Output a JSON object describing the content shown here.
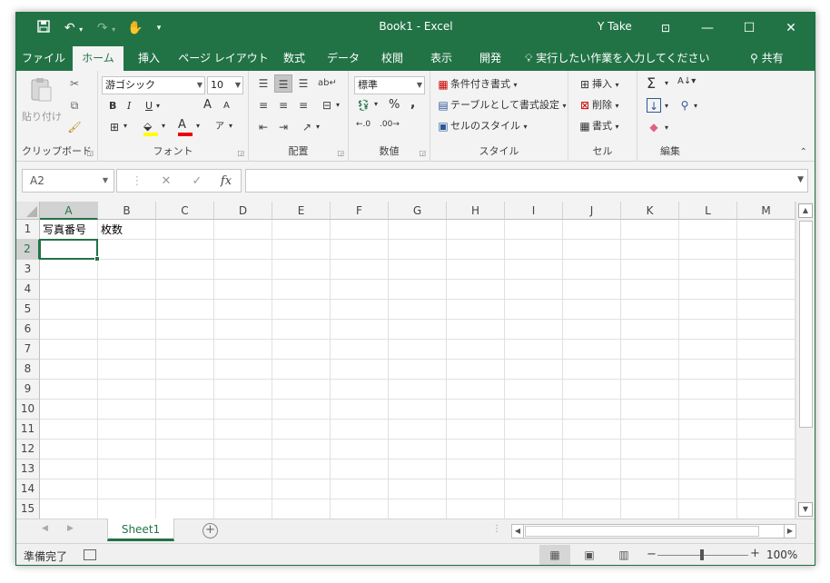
{
  "window": {
    "title": "Book1  -  Excel",
    "user": "Y Take"
  },
  "tabs": [
    "ファイル",
    "ホーム",
    "挿入",
    "ページ レイアウト",
    "数式",
    "データ",
    "校閲",
    "表示",
    "開発"
  ],
  "active_tab": "ホーム",
  "tell_me": "実行したい作業を入力してください",
  "share": "共有",
  "ribbon": {
    "clipboard": {
      "label": "クリップボード",
      "paste": "貼り付け"
    },
    "font": {
      "label": "フォント",
      "font_name": "游ゴシック",
      "font_size": "10",
      "bold": "B",
      "italic": "I",
      "underline": "U",
      "grow": "A",
      "shrink": "A"
    },
    "alignment": {
      "label": "配置"
    },
    "number": {
      "label": "数値",
      "format": "標準"
    },
    "styles": {
      "label": "スタイル",
      "conditional": "条件付き書式",
      "table": "テーブルとして書式設定",
      "cell_styles": "セルのスタイル"
    },
    "cells": {
      "label": "セル",
      "insert": "挿入",
      "delete": "削除",
      "format": "書式"
    },
    "editing": {
      "label": "編集"
    }
  },
  "formula_bar": {
    "name_box": "A2",
    "formula": "",
    "fx": "fx"
  },
  "columns": [
    "A",
    "B",
    "C",
    "D",
    "E",
    "F",
    "G",
    "H",
    "I",
    "J",
    "K",
    "L",
    "M"
  ],
  "rows": [
    "1",
    "2",
    "3",
    "4",
    "5",
    "6",
    "7",
    "8",
    "9",
    "10",
    "11",
    "12",
    "13",
    "14",
    "15"
  ],
  "cells": {
    "A1": "写真番号",
    "B1": "枚数"
  },
  "active_cell": "A2",
  "sheets": [
    "Sheet1"
  ],
  "status": {
    "ready": "準備完了",
    "zoom": "100%"
  },
  "colors": {
    "accent": "#217346",
    "ribbon_bg": "#f3f3f3"
  }
}
